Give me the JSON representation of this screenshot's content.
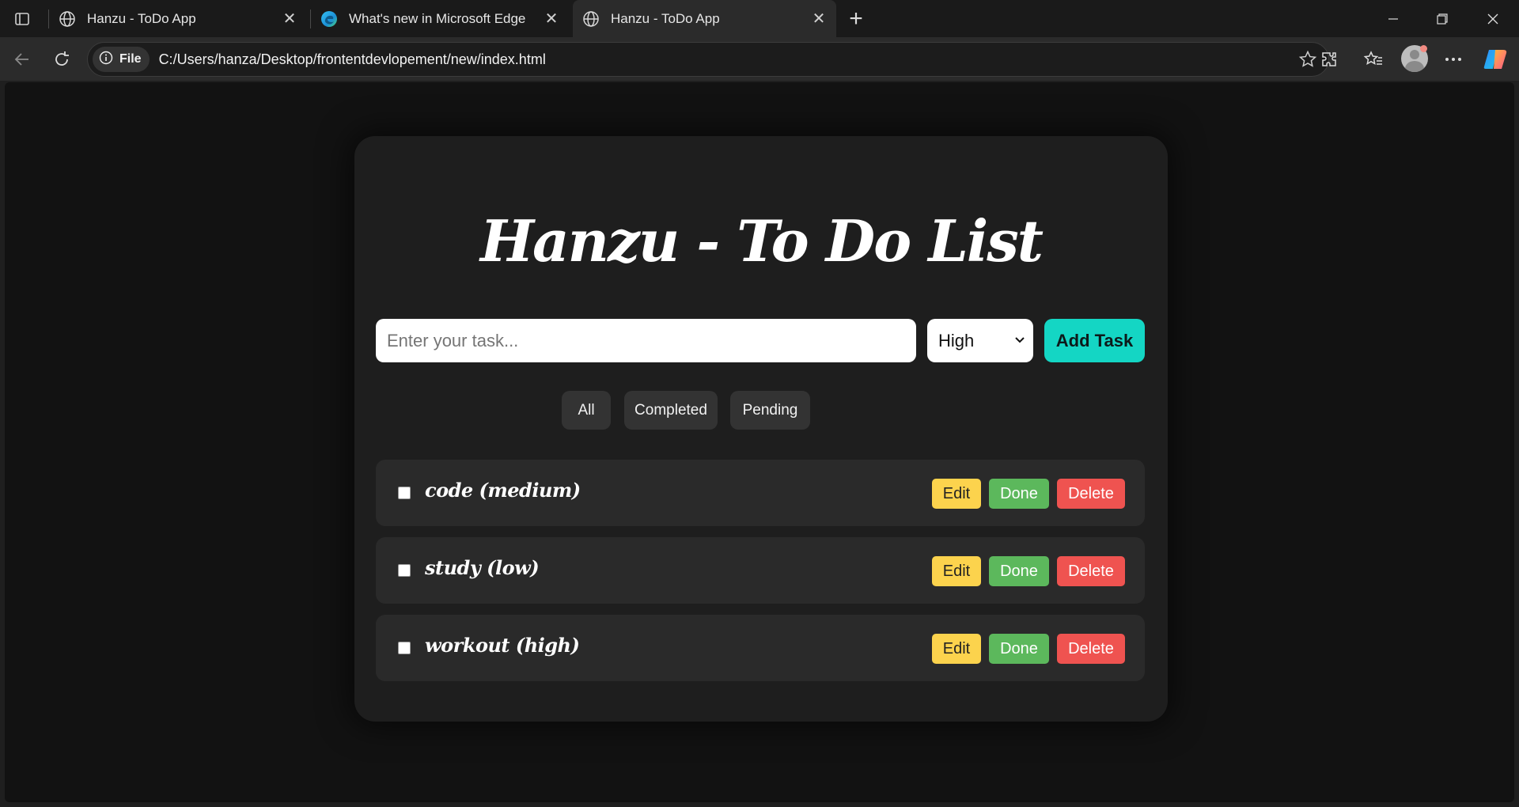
{
  "browser": {
    "tabs": [
      {
        "title": "Hanzu - ToDo App",
        "icon": "globe-icon",
        "active": false
      },
      {
        "title": "What's new in Microsoft Edge",
        "icon": "edge-icon",
        "active": false
      },
      {
        "title": "Hanzu - ToDo App",
        "icon": "globe-icon",
        "active": true
      }
    ],
    "site_info_label": "File",
    "url": "C:/Users/hanza/Desktop/frontentdevlopement/new/index.html"
  },
  "app": {
    "title": "Hanzu - To Do List",
    "input_placeholder": "Enter your task...",
    "priority_selected": "High",
    "add_button_label": "Add Task",
    "filters": [
      "All",
      "Completed",
      "Pending"
    ],
    "tasks": [
      {
        "text": "code (medium)",
        "checked": false
      },
      {
        "text": "study (low)",
        "checked": false
      },
      {
        "text": "workout (high)",
        "checked": false
      }
    ],
    "task_actions": {
      "edit": "Edit",
      "done": "Done",
      "delete": "Delete"
    }
  },
  "colors": {
    "accent": "#14d6c4",
    "edit": "#fcd34d",
    "done": "#5cb85c",
    "delete": "#ef5350",
    "card_bg": "#1e1e1e",
    "page_bg": "#121212"
  }
}
